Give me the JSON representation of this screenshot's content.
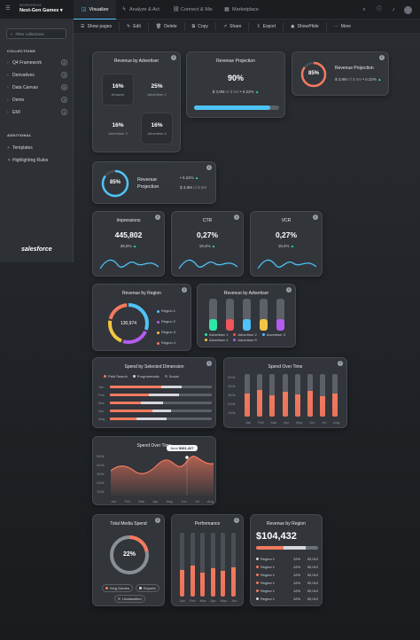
{
  "header": {
    "workspace_kicker": "WORKSPACE",
    "workspace_name": "Next-Gen Games",
    "tabs": [
      {
        "label": "Visualize"
      },
      {
        "label": "Analyze & Act"
      },
      {
        "label": "Connect & Mix"
      },
      {
        "label": "Marketplace"
      }
    ]
  },
  "toolbar": {
    "items": [
      "Show pages",
      "Edit",
      "Delete",
      "Copy",
      "Share",
      "Export",
      "Show/Hide",
      "More"
    ]
  },
  "sidebar": {
    "search_placeholder": "Filter collections",
    "collections_heading": "COLLECTIONS",
    "items": [
      {
        "label": "Q4 Framework",
        "count": "2"
      },
      {
        "label": "Derivatives",
        "count": "3"
      },
      {
        "label": "Data Canvas",
        "count": "5"
      },
      {
        "label": "Demo",
        "count": "3"
      },
      {
        "label": "EMI",
        "count": "1"
      }
    ],
    "additional_heading": "ADDITIONAL",
    "additional": [
      {
        "label": "Templates"
      },
      {
        "label": "Highlighting Rules"
      }
    ],
    "brand": "salesforce"
  },
  "rev_adv_grid": {
    "title": "Revenue by Advertiser",
    "cells": [
      {
        "value": "16%",
        "label": "Amazon"
      },
      {
        "value": "25%",
        "label": "Advertiser 2"
      },
      {
        "value": "16%",
        "label": "Advertiser 3"
      },
      {
        "value": "16%",
        "label": "Advertiser 4"
      }
    ]
  },
  "rev_proj1": {
    "title": "Revenue Projection",
    "value": "90%",
    "sub_a": "$ 3,9M",
    "sub_of": "of $ 5M",
    "sub_delta": "0.22%",
    "progress": 0.9
  },
  "rev_proj2": {
    "title": "Revenue Projection",
    "gauge": "85%",
    "sub_a": "$ 3,9M",
    "sub_of": "of $ 5M",
    "delta": "0.22%"
  },
  "rev_proj3": {
    "title_line1": "Revenue",
    "title_line2": "Projection",
    "gauge": "85%",
    "delta": "0.22%",
    "sub_a": "$ 3,9M",
    "sub_of": "of $ 5M"
  },
  "kpis": [
    {
      "title": "Impressions",
      "value": "445,802",
      "delta": "28,6%"
    },
    {
      "title": "CTR",
      "value": "0,27%",
      "delta": "18,4%"
    },
    {
      "title": "VCR",
      "value": "0,27%",
      "delta": "18,4%"
    }
  ],
  "rev_region_donut": {
    "title": "Revenue by Region",
    "center": "130,974",
    "legend": [
      "Region 1",
      "Region 2",
      "Region 3",
      "Region 4"
    ]
  },
  "rev_adv_bars": {
    "title": "Revenue by Advertiser",
    "legend": [
      "Advertiser 1",
      "Advertiser 2",
      "Advertiser 3",
      "Advertiser 4",
      "Advertiser 5"
    ],
    "levels": [
      0.35,
      0.35,
      0.35,
      0.35,
      0.35
    ]
  },
  "spend_dim": {
    "title": "Spend by Selected Dimension",
    "legend": [
      "Paid Search",
      "Programmatic",
      "Social"
    ],
    "rows": [
      "Jan",
      "Feb",
      "Mar",
      "Apr",
      "May"
    ]
  },
  "spend_time1": {
    "title": "Spend Over Time",
    "yticks": [
      "500k",
      "400k",
      "300k",
      "200k",
      "100k"
    ],
    "months": [
      "Jan",
      "Feb",
      "Mar",
      "Apr",
      "May",
      "Jun",
      "Jul",
      "Aug"
    ],
    "levels": [
      0.55,
      0.62,
      0.5,
      0.58,
      0.52,
      0.6,
      0.48,
      0.55
    ]
  },
  "spend_time2": {
    "title": "Spend Over Time",
    "tooltip_month": "June",
    "tooltip_value": "$381,427",
    "yticks": [
      "500k",
      "400k",
      "300k",
      "200k",
      "100k"
    ],
    "months": [
      "Jan",
      "Feb",
      "Mar",
      "Apr",
      "May",
      "Jun",
      "Jul",
      "Aug"
    ]
  },
  "media_spend": {
    "title": "Total Media Spend",
    "center": "22%",
    "chips": [
      "King Games",
      "Exports",
      "Unclassified"
    ]
  },
  "performance": {
    "title": "Performance",
    "months": [
      "Jan",
      "Feb",
      "Mar",
      "Apr",
      "May",
      "Jun"
    ],
    "levels": [
      0.42,
      0.48,
      0.38,
      0.45,
      0.4,
      0.46
    ]
  },
  "rev_region_table": {
    "title": "Revenue by Region",
    "total": "$104,432",
    "rows": [
      {
        "label": "Region 1",
        "pct": "12%",
        "value": "92,012"
      },
      {
        "label": "Region 1",
        "pct": "12%",
        "value": "92,012"
      },
      {
        "label": "Region 1",
        "pct": "12%",
        "value": "92,012"
      },
      {
        "label": "Region 1",
        "pct": "12%",
        "value": "92,012"
      },
      {
        "label": "Region 1",
        "pct": "12%",
        "value": "92,012"
      },
      {
        "label": "Region 1",
        "pct": "12%",
        "value": "92,012"
      }
    ]
  },
  "colors": {
    "accent": "#4fc3f7",
    "up": "#2ee6a8",
    "orange": "#f27a5e",
    "salmon": "#e8735c",
    "yellow": "#f4c542",
    "purple": "#b45cf0",
    "red": "#f2545b",
    "green": "#2ee6a8"
  }
}
